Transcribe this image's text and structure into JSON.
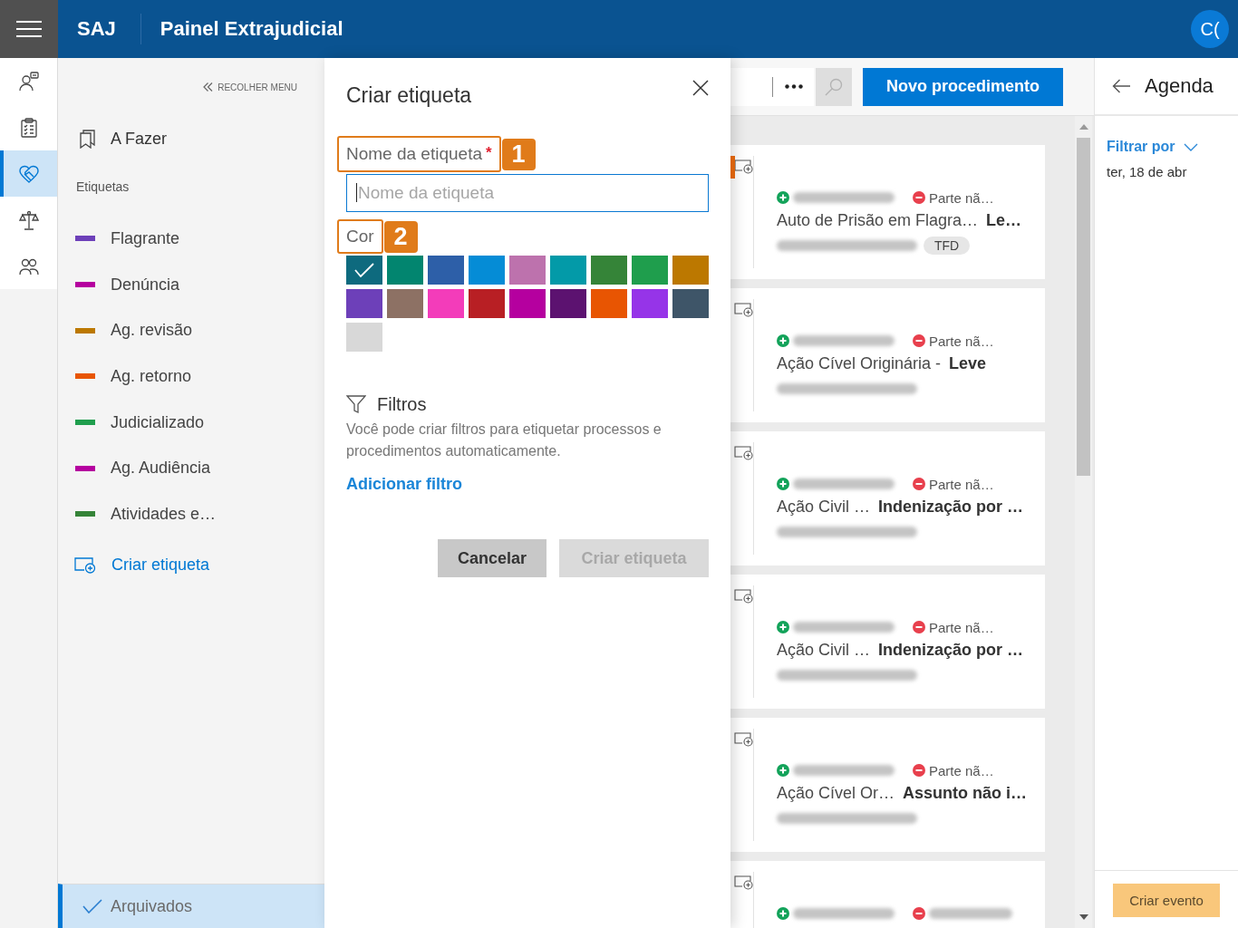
{
  "header": {
    "logo": "SAJ",
    "title": "Painel Extrajudicial",
    "avatar": "C("
  },
  "rail": {
    "items": [
      {
        "kind": "person-chat",
        "selected": false
      },
      {
        "kind": "clipboard",
        "selected": false
      },
      {
        "kind": "handshake",
        "selected": true
      },
      {
        "kind": "scales",
        "selected": false
      },
      {
        "kind": "people",
        "selected": false
      }
    ]
  },
  "menu": {
    "collapse": "RECOLHER MENU",
    "todo": {
      "label": "A Fazer",
      "selected": false
    },
    "tags_heading": "Etiquetas",
    "tags": [
      {
        "label": "Flagrante",
        "color": "#6d40b9",
        "selected": false
      },
      {
        "label": "Denúncia",
        "color": "#b5009f",
        "selected": false
      },
      {
        "label": "Ag. revisão",
        "color": "#bc7800",
        "selected": false
      },
      {
        "label": "Ag. retorno",
        "color": "#e85502",
        "selected": false
      },
      {
        "label": "Judicializado",
        "color": "#1f9e4d",
        "selected": false
      },
      {
        "label": "Ag. Audiência",
        "color": "#b5009f",
        "selected": false
      },
      {
        "label": "Atividades e…",
        "color": "#358438",
        "selected": false
      }
    ],
    "create_tag": "Criar etiqueta",
    "archived": {
      "label": "Arquivados",
      "selected": true
    }
  },
  "dialog": {
    "title": "Criar etiqueta",
    "name_label": "Nome da etiqueta",
    "required_mark": "*",
    "name_callout": "1",
    "name_placeholder": "Nome da etiqueta",
    "color_label": "Cor",
    "color_callout": "2",
    "swatches": [
      {
        "color": "#0e6a7e",
        "selected": true
      },
      {
        "color": "#02856f",
        "selected": false
      },
      {
        "color": "#2d5fa8",
        "selected": false
      },
      {
        "color": "#058cd6",
        "selected": false
      },
      {
        "color": "#bd72ad",
        "selected": false
      },
      {
        "color": "#039aa8",
        "selected": false
      },
      {
        "color": "#358438",
        "selected": false
      },
      {
        "color": "#1f9e4d",
        "selected": false
      },
      {
        "color": "#bc7800",
        "selected": false
      },
      {
        "color": "#6d40b9",
        "selected": false
      },
      {
        "color": "#8d7164",
        "selected": false
      },
      {
        "color": "#f33cba",
        "selected": false
      },
      {
        "color": "#b81f24",
        "selected": false
      },
      {
        "color": "#b5009f",
        "selected": false
      },
      {
        "color": "#5c1270",
        "selected": false
      },
      {
        "color": "#e85502",
        "selected": false
      },
      {
        "color": "#9634e8",
        "selected": false
      },
      {
        "color": "#3e5568",
        "selected": false
      },
      {
        "color": "#d8d8d8",
        "selected": false
      }
    ],
    "filters_title": "Filtros",
    "filters_text": "Você pode criar filtros para etiquetar processos e procedimentos automaticamente.",
    "add_filter": "Adicionar filtro",
    "cancel": "Cancelar",
    "submit": {
      "label": "Criar etiqueta",
      "disabled": true
    }
  },
  "toolbar": {
    "new_button": "Novo procedimento"
  },
  "cards": [
    {
      "color": "#d9620c",
      "parties": [
        {
          "kind": "included"
        },
        {
          "kind": "excluded",
          "label": "Parte nã…"
        }
      ],
      "title": "Auto de Prisão em Flagra…",
      "subject": "Le…",
      "number_blurred": true,
      "badge": "TFD"
    },
    {
      "parties": [
        {
          "kind": "included"
        },
        {
          "kind": "excluded",
          "label": "Parte nã…"
        }
      ],
      "title": "Ação Cível Originária -",
      "subject": "Leve",
      "number_blurred": true
    },
    {
      "parties": [
        {
          "kind": "included"
        },
        {
          "kind": "excluded",
          "label": "Parte nã…"
        }
      ],
      "title": "Ação Civil …",
      "subject": "Indenização por …",
      "number_blurred": true
    },
    {
      "parties": [
        {
          "kind": "included"
        },
        {
          "kind": "excluded",
          "label": "Parte nã…"
        }
      ],
      "title": "Ação Civil …",
      "subject": "Indenização por …",
      "number_blurred": true
    },
    {
      "parties": [
        {
          "kind": "included"
        },
        {
          "kind": "excluded",
          "label": "Parte nã…"
        }
      ],
      "title": "Ação Cível Or…",
      "subject": "Assunto não i…",
      "number_blurred": true
    },
    {
      "parties": [
        {
          "kind": "included"
        },
        {
          "kind": "excluded"
        }
      ]
    }
  ],
  "agenda": {
    "title": "Agenda",
    "filter": "Filtrar por",
    "date": "ter, 18 de abr",
    "create_event": "Criar evento"
  }
}
